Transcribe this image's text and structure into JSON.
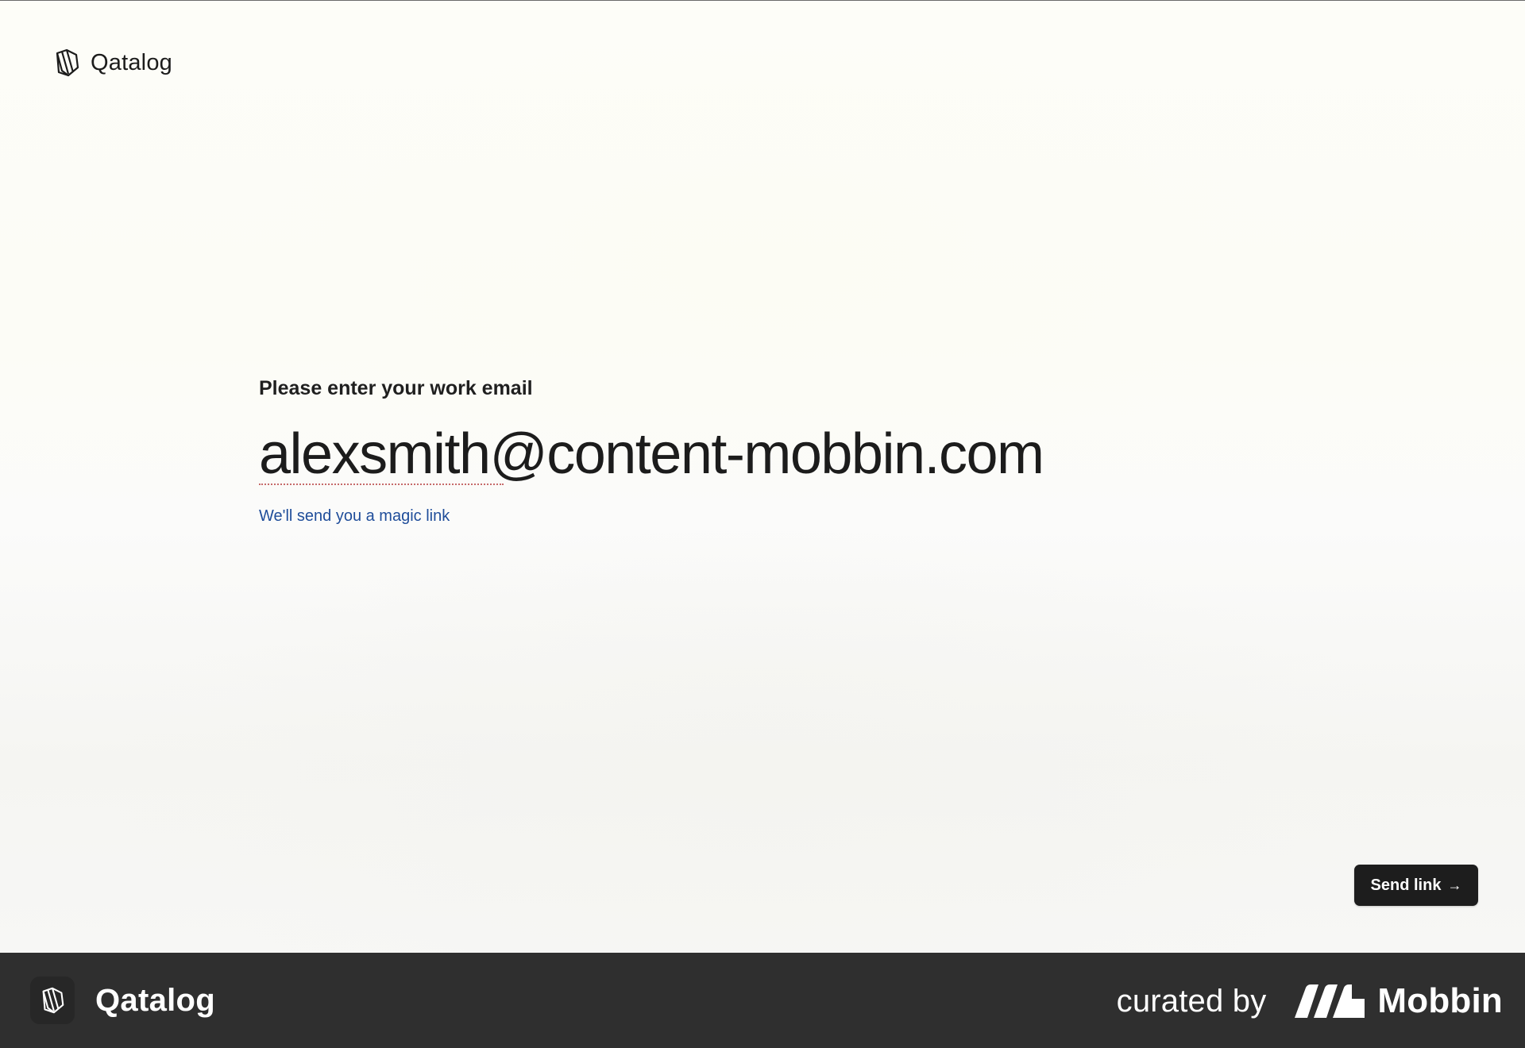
{
  "header": {
    "brand": "Qatalog",
    "logo_icon": "qatalog-logo-icon"
  },
  "form": {
    "prompt": "Please enter your work email",
    "email_value": "alexsmith@content-mobbin.com",
    "hint": "We'll send you a magic link"
  },
  "actions": {
    "send_label": "Send link",
    "send_icon": "arrow-right-icon",
    "send_arrow": "→"
  },
  "footer": {
    "app_name": "Qatalog",
    "curated_by": "curated by",
    "brand": "Mobbin",
    "brand_icon": "mobbin-logo-icon"
  },
  "colors": {
    "hint_link": "#1f4d9a",
    "button_bg": "#1d1d1d",
    "footer_bg": "#2f2f2f",
    "text_primary": "#1c1c1c"
  }
}
